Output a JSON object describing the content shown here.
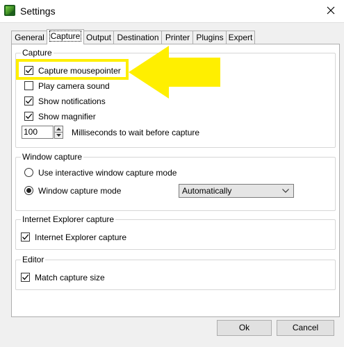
{
  "window": {
    "title": "Settings",
    "app_icon": "greenshot-icon",
    "close_icon": "close-icon"
  },
  "tabs": [
    {
      "label": "General"
    },
    {
      "label": "Capture",
      "active": true
    },
    {
      "label": "Output"
    },
    {
      "label": "Destination"
    },
    {
      "label": "Printer"
    },
    {
      "label": "Plugins"
    },
    {
      "label": "Expert"
    }
  ],
  "capture_group": {
    "title": "Capture",
    "options": [
      {
        "label": "Capture mousepointer",
        "checked": true
      },
      {
        "label": "Play camera sound",
        "checked": false
      },
      {
        "label": "Show notifications",
        "checked": true
      },
      {
        "label": "Show magnifier",
        "checked": true
      }
    ],
    "wait": {
      "value": "100",
      "label": "Milliseconds to wait before capture"
    }
  },
  "window_capture_group": {
    "title": "Window capture",
    "options": [
      {
        "label": "Use interactive window capture mode",
        "selected": false
      },
      {
        "label": "Window capture mode",
        "selected": true
      }
    ],
    "mode_select": {
      "value": "Automatically"
    }
  },
  "ie_group": {
    "title": "Internet Explorer capture",
    "option": {
      "label": "Internet Explorer capture",
      "checked": true
    }
  },
  "editor_group": {
    "title": "Editor",
    "option": {
      "label": "Match capture size",
      "checked": true
    }
  },
  "buttons": {
    "ok": "Ok",
    "cancel": "Cancel"
  },
  "annotation": {
    "highlight_color": "#ffef00"
  }
}
